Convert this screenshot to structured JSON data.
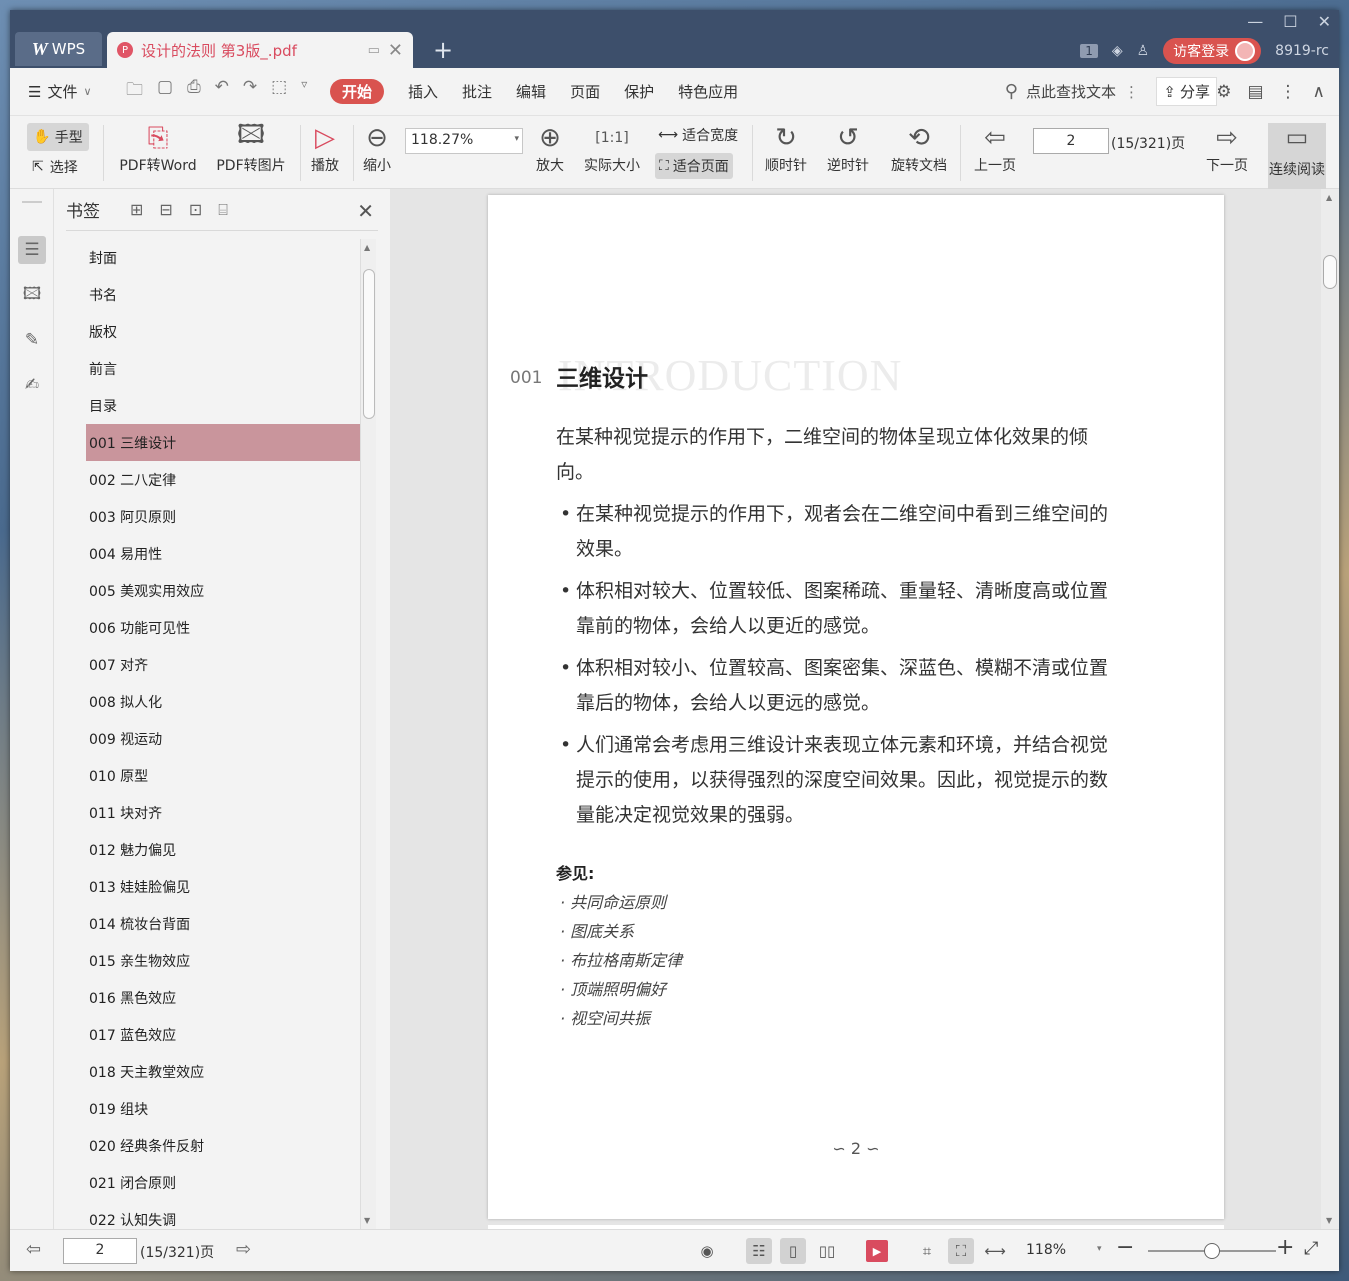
{
  "titlebar": {
    "app_tab": "WPS",
    "doc_tab": "设计的法则 第3版_.pdf",
    "badge": "1",
    "login": "访客登录",
    "user": "8919-rc"
  },
  "menubar": {
    "file": "文件",
    "tabs": [
      "开始",
      "插入",
      "批注",
      "编辑",
      "页面",
      "保护",
      "特色应用"
    ],
    "search": "点此查找文本",
    "share": "分享"
  },
  "toolbar": {
    "hand": "手型",
    "select": "选择",
    "pdf_to_word": "PDF转Word",
    "pdf_to_image": "PDF转图片",
    "play": "播放",
    "zoom_out": "缩小",
    "zoom_value": "118.27%",
    "zoom_in": "放大",
    "actual_size": "实际大小",
    "fit_width": "适合宽度",
    "fit_page": "适合页面",
    "clockwise": "顺时针",
    "counterclockwise": "逆时针",
    "rotate_doc": "旋转文档",
    "prev_page": "上一页",
    "page_value": "2",
    "page_total": "(15/321)页",
    "next_page": "下一页",
    "continuous": "连续阅读"
  },
  "bookmarks": {
    "title": "书签",
    "items": [
      "封面",
      "书名",
      "版权",
      "前言",
      "目录",
      "001 三维设计",
      "002 二八定律",
      "003 阿贝原则",
      "004 易用性",
      "005 美观实用效应",
      "006 功能可见性",
      "007 对齐",
      "008 拟人化",
      "009 视运动",
      "010 原型",
      "011 块对齐",
      "012 魅力偏见",
      "013 娃娃脸偏见",
      "014 梳妆台背面",
      "015 亲生物效应",
      "016 黑色效应",
      "017 蓝色效应",
      "018 天主教堂效应",
      "019 组块",
      "020 经典条件反射",
      "021 闭合原则",
      "022 认知失调"
    ],
    "selected_index": 5
  },
  "page": {
    "ghost_text": "INTRODUCTION",
    "section_number": "001",
    "section_title": "三维设计",
    "intro": "在某种视觉提示的作用下，二维空间的物体呈现立体化效果的倾向。",
    "bullets": [
      "在某种视觉提示的作用下，观者会在二维空间中看到三维空间的效果。",
      "体积相对较大、位置较低、图案稀疏、重量轻、清晰度高或位置靠前的物体，会给人以更近的感觉。",
      "体积相对较小、位置较高、图案密集、深蓝色、模糊不清或位置靠后的物体，会给人以更远的感觉。",
      "人们通常会考虑用三维设计来表现立体元素和环境，并结合视觉提示的使用，以获得强烈的深度空间效果。因此，视觉提示的数量能决定视觉效果的强弱。"
    ],
    "see_also_label": "参见:",
    "see_also": [
      "共同命运原则",
      "图底关系",
      "布拉格南斯定律",
      "顶端照明偏好",
      "视空间共振"
    ],
    "footer": "∽ 2 ∽"
  },
  "statusbar": {
    "page_value": "2",
    "page_total": "(15/321)页",
    "zoom": "118%",
    "zoom_fraction": 0.5
  }
}
